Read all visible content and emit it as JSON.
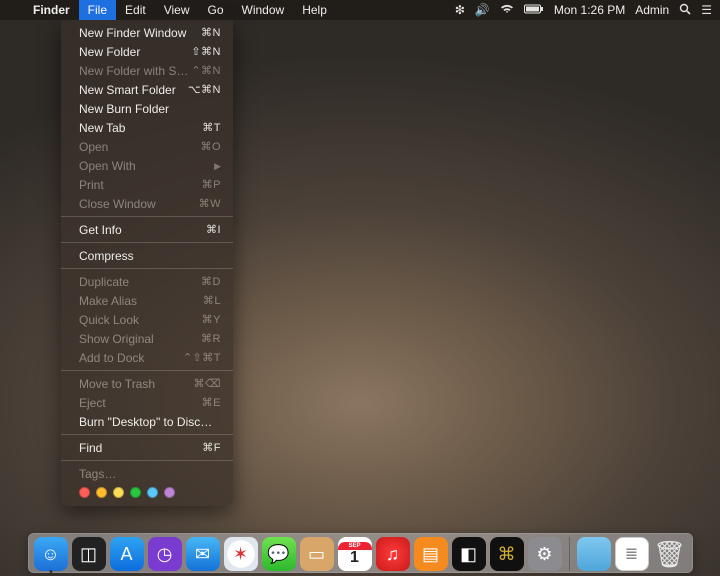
{
  "menubar": {
    "app": "Finder",
    "items": [
      "File",
      "Edit",
      "View",
      "Go",
      "Window",
      "Help"
    ],
    "active_index": 0,
    "status": {
      "time": "Mon 1:26 PM",
      "user": "Admin"
    }
  },
  "dropdown": {
    "groups": [
      [
        {
          "label": "New Finder Window",
          "shortcut": "⌘N",
          "enabled": true
        },
        {
          "label": "New Folder",
          "shortcut": "⇧⌘N",
          "enabled": true
        },
        {
          "label": "New Folder with Selection",
          "shortcut": "⌃⌘N",
          "enabled": false
        },
        {
          "label": "New Smart Folder",
          "shortcut": "⌥⌘N",
          "enabled": true
        },
        {
          "label": "New Burn Folder",
          "shortcut": "",
          "enabled": true
        },
        {
          "label": "New Tab",
          "shortcut": "⌘T",
          "enabled": true
        },
        {
          "label": "Open",
          "shortcut": "⌘O",
          "enabled": false
        },
        {
          "label": "Open With",
          "shortcut": "▸",
          "enabled": false,
          "submenu": true
        },
        {
          "label": "Print",
          "shortcut": "⌘P",
          "enabled": false
        },
        {
          "label": "Close Window",
          "shortcut": "⌘W",
          "enabled": false
        }
      ],
      [
        {
          "label": "Get Info",
          "shortcut": "⌘I",
          "enabled": true
        }
      ],
      [
        {
          "label": "Compress",
          "shortcut": "",
          "enabled": true
        }
      ],
      [
        {
          "label": "Duplicate",
          "shortcut": "⌘D",
          "enabled": false
        },
        {
          "label": "Make Alias",
          "shortcut": "⌘L",
          "enabled": false
        },
        {
          "label": "Quick Look",
          "shortcut": "⌘Y",
          "enabled": false
        },
        {
          "label": "Show Original",
          "shortcut": "⌘R",
          "enabled": false
        },
        {
          "label": "Add to Dock",
          "shortcut": "⌃⇧⌘T",
          "enabled": false
        }
      ],
      [
        {
          "label": "Move to Trash",
          "shortcut": "⌘⌫",
          "enabled": false
        },
        {
          "label": "Eject",
          "shortcut": "⌘E",
          "enabled": false
        },
        {
          "label": "Burn \"Desktop\" to Disc…",
          "shortcut": "",
          "enabled": true
        }
      ],
      [
        {
          "label": "Find",
          "shortcut": "⌘F",
          "enabled": true
        }
      ],
      [
        {
          "label": "Tags…",
          "shortcut": "",
          "enabled": false
        }
      ]
    ],
    "tag_colors": [
      "#ff5f57",
      "#ffbd2e",
      "#ffde57",
      "#28c840",
      "#5ac8fa",
      "#c084d6"
    ]
  },
  "dock": {
    "apps": [
      {
        "name": "Finder",
        "cls": "di-finder",
        "glyph": "☺",
        "running": true
      },
      {
        "name": "Mission Control",
        "cls": "di-mc",
        "glyph": "◫"
      },
      {
        "name": "App Store",
        "cls": "di-appstore",
        "glyph": "A"
      },
      {
        "name": "Activity Monitor",
        "cls": "di-activity",
        "glyph": "◷"
      },
      {
        "name": "Mail",
        "cls": "di-mail",
        "glyph": "✉"
      },
      {
        "name": "Safari",
        "cls": "di-safari",
        "glyph": "✶"
      },
      {
        "name": "Messages",
        "cls": "di-msg",
        "glyph": "💬"
      },
      {
        "name": "Contacts",
        "cls": "di-contacts",
        "glyph": "▭"
      },
      {
        "name": "Calendar",
        "cls": "di-cal",
        "glyph": "1",
        "cal_month": "SEP",
        "cal_day": "1"
      },
      {
        "name": "iTunes",
        "cls": "di-itunes",
        "glyph": "♫"
      },
      {
        "name": "iBooks",
        "cls": "di-ibooks",
        "glyph": "▤"
      },
      {
        "name": "Photo Booth",
        "cls": "di-photo",
        "glyph": "◧"
      },
      {
        "name": "System Information",
        "cls": "di-sys",
        "glyph": "⌘"
      },
      {
        "name": "System Preferences",
        "cls": "di-pref",
        "glyph": "⚙"
      }
    ],
    "right": [
      {
        "name": "Downloads",
        "cls": "di-folder",
        "glyph": ""
      },
      {
        "name": "Document",
        "cls": "di-doc",
        "glyph": "≣"
      },
      {
        "name": "Trash",
        "cls": "di-trash",
        "glyph": "🗑"
      }
    ]
  }
}
